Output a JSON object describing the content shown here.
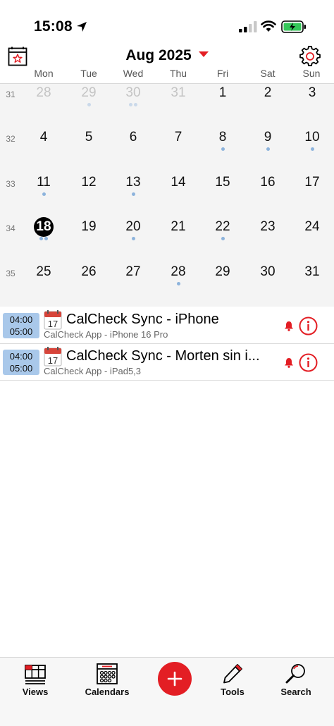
{
  "status_bar": {
    "time": "15:08"
  },
  "header": {
    "month_title": "Aug 2025"
  },
  "weekdays": [
    "Mon",
    "Tue",
    "Wed",
    "Thu",
    "Fri",
    "Sat",
    "Sun"
  ],
  "weeks": [
    {
      "week_number": "31",
      "days": [
        {
          "label": "28",
          "dim": true,
          "dots": 0
        },
        {
          "label": "29",
          "dim": true,
          "dots": 1
        },
        {
          "label": "30",
          "dim": true,
          "dots": 2
        },
        {
          "label": "31",
          "dim": true,
          "dots": 0
        },
        {
          "label": "1",
          "dim": false,
          "dots": 0
        },
        {
          "label": "2",
          "dim": false,
          "dots": 0
        },
        {
          "label": "3",
          "dim": false,
          "dots": 0
        }
      ]
    },
    {
      "week_number": "32",
      "days": [
        {
          "label": "4",
          "dim": false,
          "dots": 0
        },
        {
          "label": "5",
          "dim": false,
          "dots": 0
        },
        {
          "label": "6",
          "dim": false,
          "dots": 0
        },
        {
          "label": "7",
          "dim": false,
          "dots": 0
        },
        {
          "label": "8",
          "dim": false,
          "dots": 1
        },
        {
          "label": "9",
          "dim": false,
          "dots": 1
        },
        {
          "label": "10",
          "dim": false,
          "dots": 1
        }
      ]
    },
    {
      "week_number": "33",
      "days": [
        {
          "label": "11",
          "dim": false,
          "dots": 1
        },
        {
          "label": "12",
          "dim": false,
          "dots": 0
        },
        {
          "label": "13",
          "dim": false,
          "dots": 1
        },
        {
          "label": "14",
          "dim": false,
          "dots": 0
        },
        {
          "label": "15",
          "dim": false,
          "dots": 0
        },
        {
          "label": "16",
          "dim": false,
          "dots": 0
        },
        {
          "label": "17",
          "dim": false,
          "dots": 0
        }
      ]
    },
    {
      "week_number": "34",
      "days": [
        {
          "label": "18",
          "dim": false,
          "dots": 2,
          "today": true
        },
        {
          "label": "19",
          "dim": false,
          "dots": 0
        },
        {
          "label": "20",
          "dim": false,
          "dots": 1
        },
        {
          "label": "21",
          "dim": false,
          "dots": 0
        },
        {
          "label": "22",
          "dim": false,
          "dots": 1
        },
        {
          "label": "23",
          "dim": false,
          "dots": 0
        },
        {
          "label": "24",
          "dim": false,
          "dots": 0
        }
      ]
    },
    {
      "week_number": "35",
      "days": [
        {
          "label": "25",
          "dim": false,
          "dots": 0
        },
        {
          "label": "26",
          "dim": false,
          "dots": 0
        },
        {
          "label": "27",
          "dim": false,
          "dots": 0
        },
        {
          "label": "28",
          "dim": false,
          "dots": 1
        },
        {
          "label": "29",
          "dim": false,
          "dots": 0
        },
        {
          "label": "30",
          "dim": false,
          "dots": 0
        },
        {
          "label": "31",
          "dim": false,
          "dots": 0
        }
      ]
    }
  ],
  "events": [
    {
      "start": "04:00",
      "end": "05:00",
      "icon_day": "17",
      "title": "CalCheck Sync - iPhone",
      "subtitle": "CalCheck App - iPhone 16 Pro"
    },
    {
      "start": "04:00",
      "end": "05:00",
      "icon_day": "17",
      "title": "CalCheck Sync - Morten sin i...",
      "subtitle": "CalCheck App - iPad5,3"
    }
  ],
  "tabbar": {
    "views": "Views",
    "calendars": "Calendars",
    "tools": "Tools",
    "search": "Search"
  },
  "colors": {
    "accent": "#e31e24",
    "event_time_bg": "#a9c8ea",
    "event_dot": "#8db3dc",
    "grid_bg": "#f4f4f4"
  },
  "icons": {
    "header_left": "calendar-star-icon",
    "header_right": "gear-icon",
    "event_icon": "calendar-icon",
    "bell": "bell-icon",
    "info": "info-icon",
    "views": "views-grid-icon",
    "calendars": "calendar-grid-icon",
    "add": "plus-icon",
    "tools": "pencil-icon",
    "search": "search-icon"
  }
}
